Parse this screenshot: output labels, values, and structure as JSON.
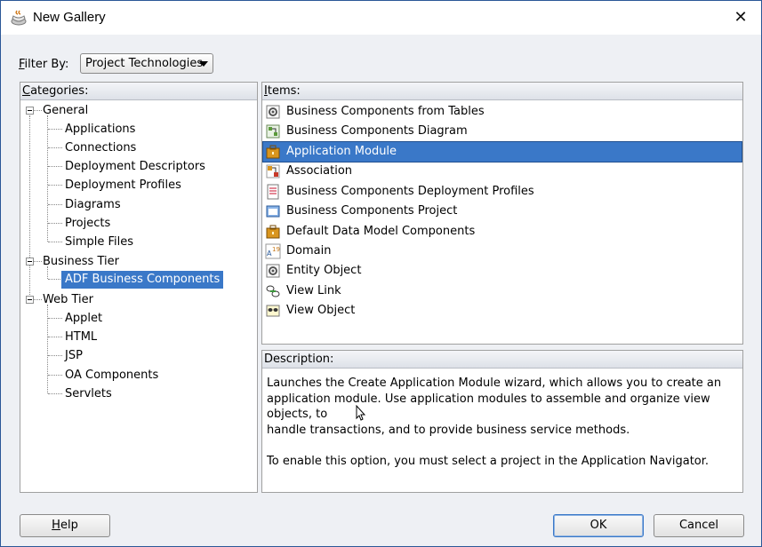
{
  "window": {
    "title": "New Gallery",
    "close_glyph": "✕"
  },
  "filter": {
    "label_prefix": "F",
    "label_rest": "ilter By:",
    "value": "Project Technologies"
  },
  "categories": {
    "header_u": "C",
    "header_rest": "ategories:",
    "groups": [
      {
        "label": "General",
        "children": [
          "Applications",
          "Connections",
          "Deployment Descriptors",
          "Deployment Profiles",
          "Diagrams",
          "Projects",
          "Simple Files"
        ]
      },
      {
        "label": "Business Tier",
        "children": [
          "ADF Business Components"
        ]
      },
      {
        "label": "Web Tier",
        "children": [
          "Applet",
          "HTML",
          "JSP",
          "OA Components",
          "Servlets"
        ]
      }
    ],
    "selected": "ADF Business Components"
  },
  "items": {
    "header_u": "I",
    "header_rest": "tems:",
    "list": [
      {
        "label": "Business Components from Tables",
        "icon": "gear-table-icon"
      },
      {
        "label": "Business Components Diagram",
        "icon": "diagram-icon"
      },
      {
        "label": "Application Module",
        "icon": "briefcase-icon"
      },
      {
        "label": "Association",
        "icon": "association-icon"
      },
      {
        "label": "Business Components Deployment Profiles",
        "icon": "deployment-profile-icon"
      },
      {
        "label": "Business Components Project",
        "icon": "project-icon"
      },
      {
        "label": "Default Data Model Components",
        "icon": "briefcase-icon"
      },
      {
        "label": "Domain",
        "icon": "domain-icon"
      },
      {
        "label": "Entity Object",
        "icon": "entity-object-icon"
      },
      {
        "label": "View Link",
        "icon": "view-link-icon"
      },
      {
        "label": "View Object",
        "icon": "view-object-icon"
      }
    ],
    "selected_index": 2
  },
  "description": {
    "header": "Description:",
    "text": "Launches the Create Application Module wizard, which allows you to create an\napplication module. Use application modules to assemble and organize view objects, to\nhandle transactions, and to provide business service methods.\n\nTo enable this option, you must select a project in the Application Navigator."
  },
  "buttons": {
    "help_u": "H",
    "help_rest": "elp",
    "ok": "OK",
    "cancel": "Cancel"
  },
  "colors": {
    "selection": "#3a78c8",
    "window_border": "#2b5797"
  }
}
